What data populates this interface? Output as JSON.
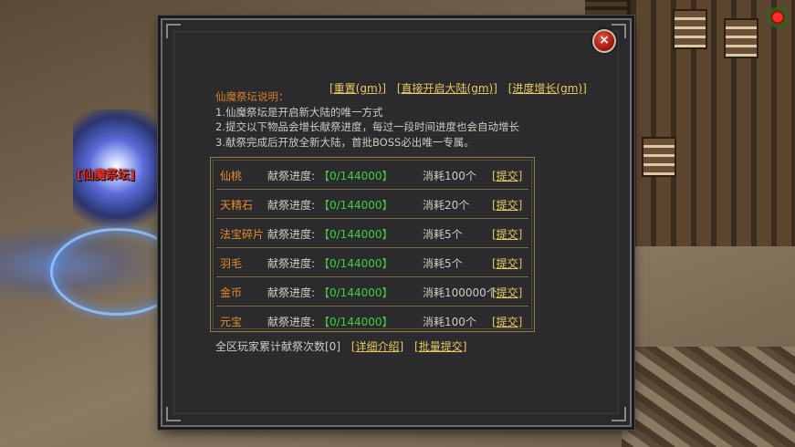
{
  "scene": {
    "altar_label": "[仙魔祭坛]"
  },
  "dialog": {
    "close_label": "×",
    "top_links": [
      {
        "label": "[重置(gm)]"
      },
      {
        "label": "[直接开启大陆(gm)]"
      },
      {
        "label": "[进度增长(gm)]"
      }
    ],
    "description": {
      "title": "仙魔祭坛说明：",
      "lines": [
        "1.仙魔祭坛是开启新大陆的唯一方式",
        "2.提交以下物品会增长献祭进度，每过一段时间进度也会自动增长",
        "3.献祭完成后开放全新大陆，首批BOSS必出唯一专属。"
      ]
    },
    "progress_label": "献祭进度:",
    "submit_label": "[提交]",
    "items": [
      {
        "name": "仙桃",
        "progress": "【0/144000】",
        "cost": "消耗100个"
      },
      {
        "name": "天精石",
        "progress": "【0/144000】",
        "cost": "消耗20个"
      },
      {
        "name": "法宝碎片",
        "progress": "【0/144000】",
        "cost": "消耗5个"
      },
      {
        "name": "羽毛",
        "progress": "【0/144000】",
        "cost": "消耗5个"
      },
      {
        "name": "金币",
        "progress": "【0/144000】",
        "cost": "消耗100000个"
      },
      {
        "name": "元宝",
        "progress": "【0/144000】",
        "cost": "消耗100个"
      }
    ],
    "footer": {
      "count_text": "全区玩家累计献祭次数[0]",
      "detail_label": "[详细介绍]",
      "batch_label": "[批量提交]"
    }
  },
  "colors": {
    "link": "#e9c95f",
    "item_name": "#e58a2c",
    "progress_value": "#3bd13b",
    "panel_bg": "#2a2a2c"
  }
}
